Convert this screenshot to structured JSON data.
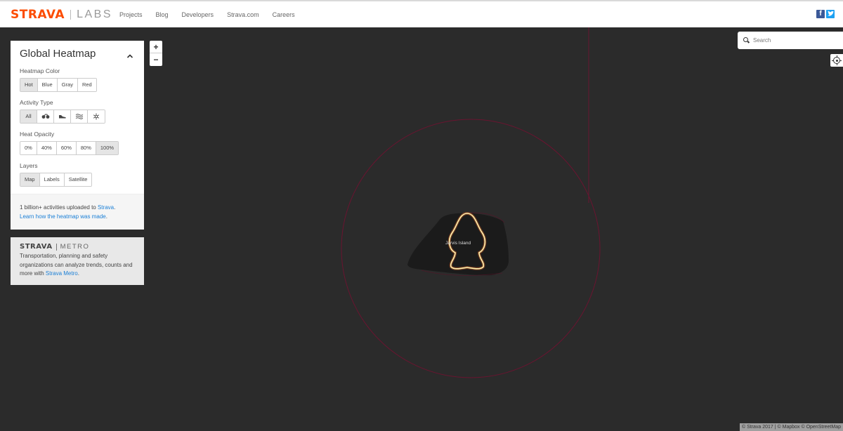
{
  "header": {
    "brand": "STRAVA",
    "brand_sub": "LABS",
    "nav": [
      "Projects",
      "Blog",
      "Developers",
      "Strava.com",
      "Careers"
    ],
    "social_icons": [
      "facebook-icon",
      "twitter-icon"
    ],
    "brand_color": "#fc4c02"
  },
  "panel": {
    "title": "Global Heatmap",
    "heatmap_color": {
      "label": "Heatmap Color",
      "options": [
        "Hot",
        "Blue",
        "Gray",
        "Red"
      ],
      "selected": "Hot"
    },
    "activity_type": {
      "label": "Activity Type",
      "options": [
        {
          "label": "All",
          "icon": ""
        },
        {
          "label": "",
          "icon": "bike-icon"
        },
        {
          "label": "",
          "icon": "run-shoe-icon"
        },
        {
          "label": "",
          "icon": "water-icon"
        },
        {
          "label": "",
          "icon": "snowflake-icon"
        }
      ],
      "selected": "All"
    },
    "heat_opacity": {
      "label": "Heat Opacity",
      "options": [
        "0%",
        "40%",
        "60%",
        "80%",
        "100%"
      ],
      "selected": "100%"
    },
    "layers": {
      "label": "Layers",
      "options": [
        "Map",
        "Labels",
        "Satellite"
      ],
      "selected": "Map"
    },
    "footer": {
      "text_before": "1 billion+ activities uploaded to ",
      "strava_link": "Strava",
      "text_after": ".",
      "learn_link": "Learn how the heatmap was made",
      "learn_after": "."
    }
  },
  "metro": {
    "brand": "STRAVA",
    "sub": "METRO",
    "text": "Transportation, planning and safety organizations can analyze trends, counts and more with ",
    "link": "Strava Metro",
    "after": "."
  },
  "zoom": {
    "in": "+",
    "out": "−"
  },
  "search": {
    "placeholder": "Search",
    "value": ""
  },
  "map": {
    "label": "Jarvis Island",
    "background_color": "#2b2b2b",
    "heat_color": "#fff3b0",
    "track_color": "#6a1430"
  },
  "attribution": "© Strava 2017 | © Mapbox © OpenStreetMap"
}
